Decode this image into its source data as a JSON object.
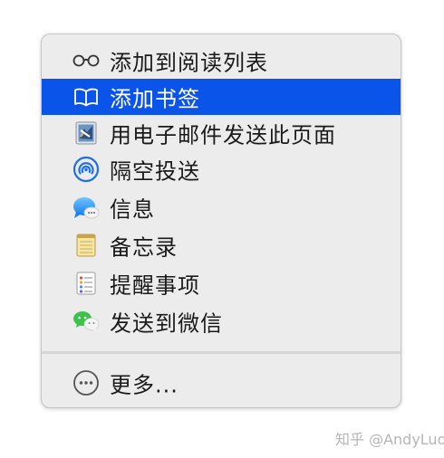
{
  "menu": {
    "items": [
      {
        "label": "添加到阅读列表",
        "icon": "glasses-icon",
        "selected": false
      },
      {
        "label": "添加书签",
        "icon": "book-icon",
        "selected": true
      },
      {
        "label": "用电子邮件发送此页面",
        "icon": "mail-icon",
        "selected": false
      },
      {
        "label": "隔空投送",
        "icon": "airdrop-icon",
        "selected": false
      },
      {
        "label": "信息",
        "icon": "messages-icon",
        "selected": false
      },
      {
        "label": "备忘录",
        "icon": "notes-icon",
        "selected": false
      },
      {
        "label": "提醒事项",
        "icon": "reminders-icon",
        "selected": false
      },
      {
        "label": "发送到微信",
        "icon": "wechat-icon",
        "selected": false
      }
    ],
    "more": {
      "label": "更多...",
      "icon": "more-icon"
    }
  },
  "watermark": "知乎 @AndyLuo",
  "colors": {
    "highlight": "#0a54e9",
    "menu_bg": "#ececec",
    "text": "#1a1a1a"
  }
}
